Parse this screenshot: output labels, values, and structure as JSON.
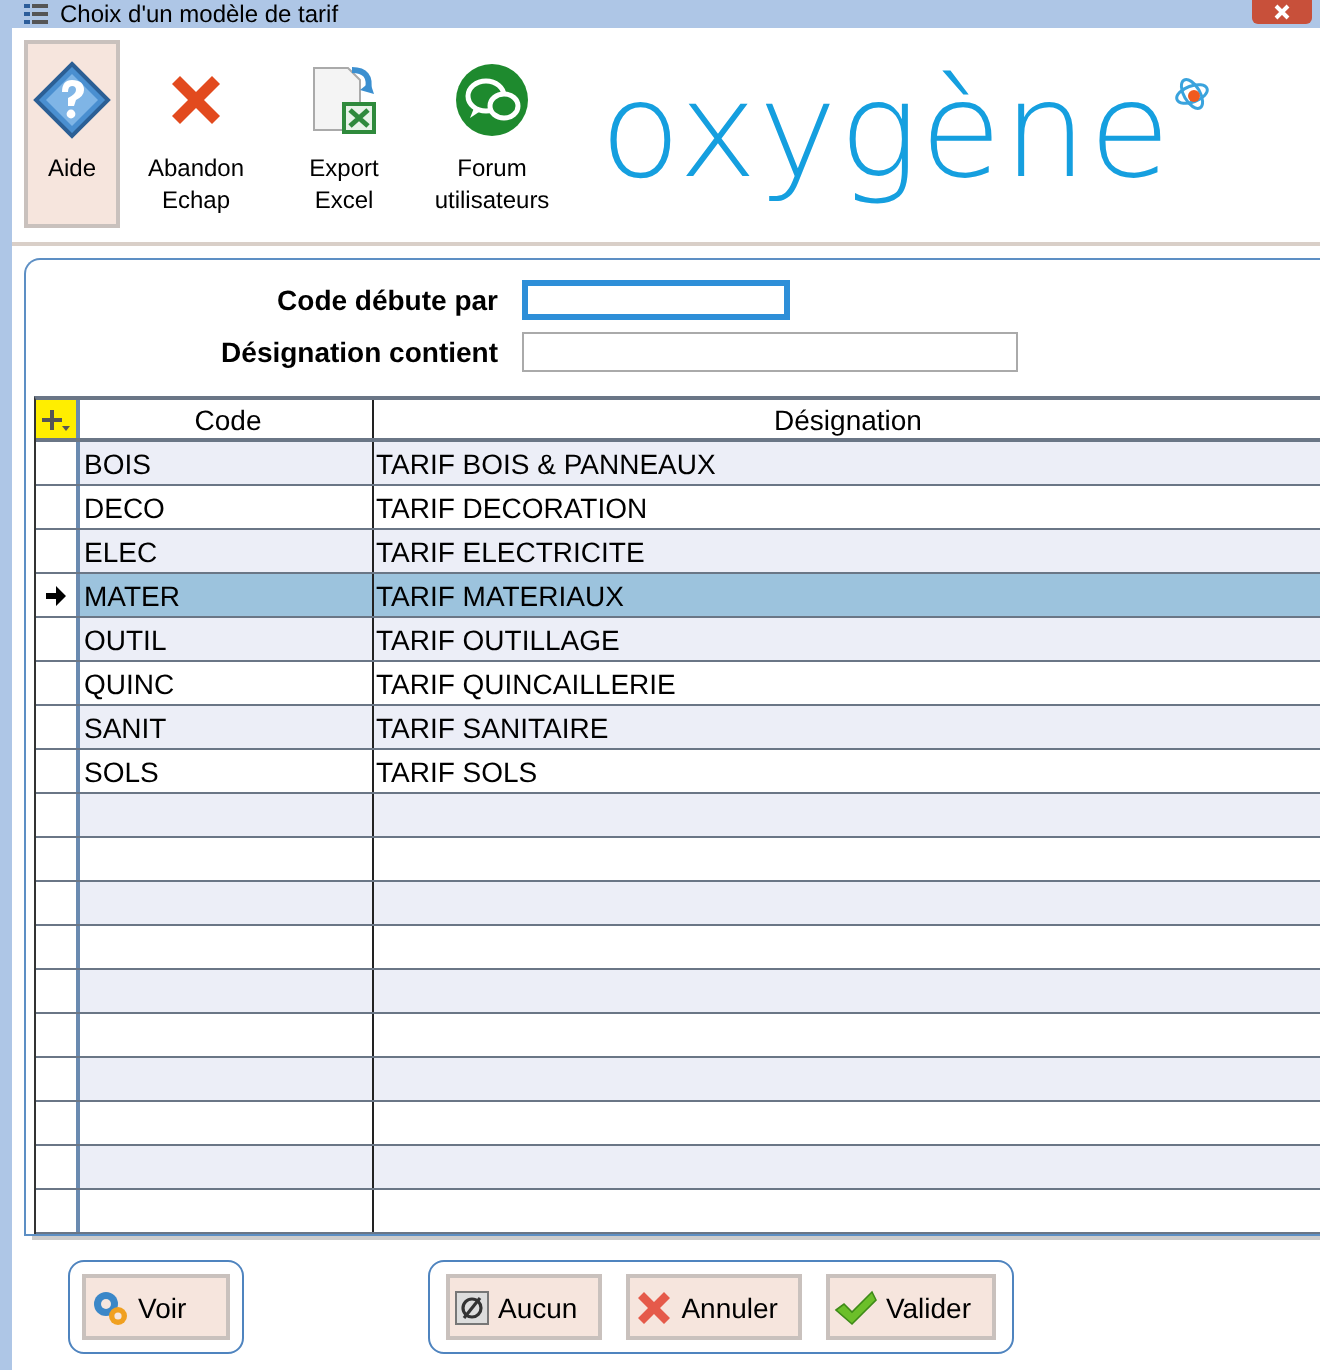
{
  "window": {
    "title": "Choix d'un modèle de tarif"
  },
  "toolbar": [
    {
      "kind": "help",
      "label": "Aide",
      "selected": true
    },
    {
      "kind": "cancel",
      "label": "Abandon\nEchap",
      "selected": false
    },
    {
      "kind": "excel",
      "label": "Export\nExcel",
      "selected": false
    },
    {
      "kind": "forum",
      "label": "Forum\nutilisateurs",
      "selected": false
    }
  ],
  "logo": {
    "text": "oxygène"
  },
  "filters": [
    {
      "label": "Code débute par",
      "focused": true
    },
    {
      "label": "Désignation contient",
      "focused": false
    }
  ],
  "table": {
    "columns": [
      "Code",
      "Désignation"
    ],
    "rows": [
      {
        "code": "BOIS",
        "designation": "TARIF BOIS & PANNEAUX",
        "selected": false
      },
      {
        "code": "DECO",
        "designation": "TARIF DECORATION",
        "selected": false
      },
      {
        "code": "ELEC",
        "designation": "TARIF ELECTRICITE",
        "selected": false
      },
      {
        "code": "MATER",
        "designation": "TARIF MATERIAUX",
        "selected": true
      },
      {
        "code": "OUTIL",
        "designation": "TARIF OUTILLAGE",
        "selected": false
      },
      {
        "code": "QUINC",
        "designation": "TARIF QUINCAILLERIE",
        "selected": false
      },
      {
        "code": "SANIT",
        "designation": "TARIF SANITAIRE",
        "selected": false
      },
      {
        "code": "SOLS",
        "designation": "TARIF SOLS",
        "selected": false
      }
    ]
  },
  "footer": {
    "left": [
      {
        "kind": "view",
        "label": "Voir"
      }
    ],
    "right": [
      {
        "kind": "none",
        "label": "Aucun"
      },
      {
        "kind": "cancel",
        "label": "Annuler"
      },
      {
        "kind": "ok",
        "label": "Valider"
      }
    ]
  }
}
